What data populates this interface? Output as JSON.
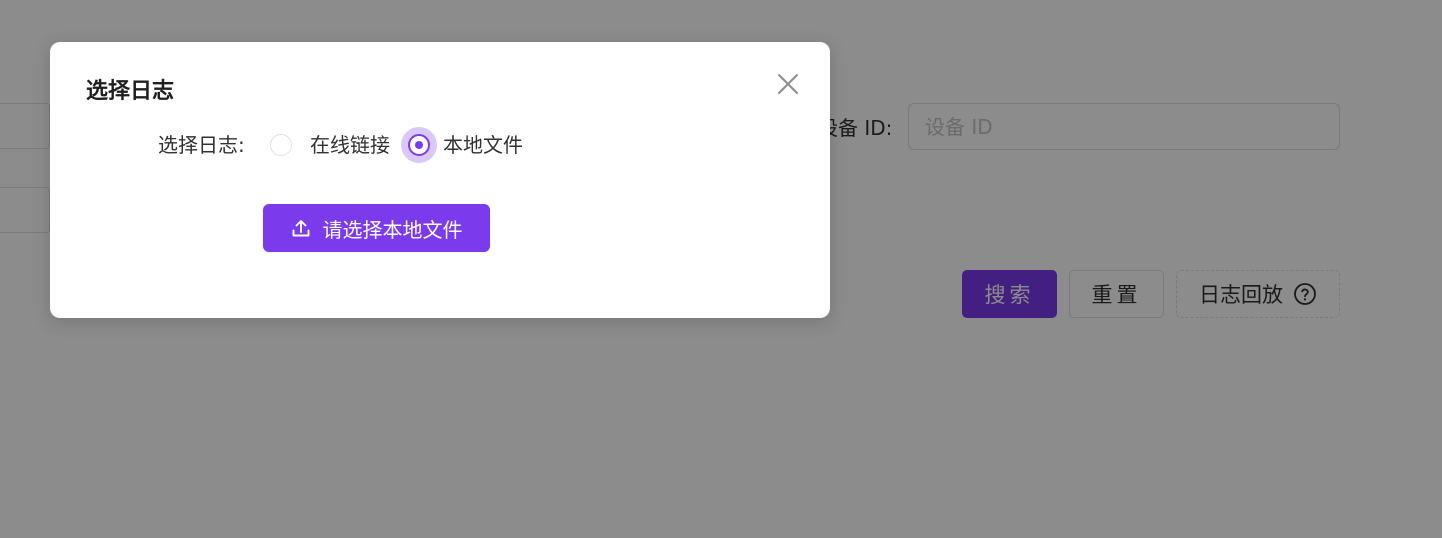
{
  "background": {
    "device_id_label": "设备 ID:",
    "device_id_placeholder": "设备 ID",
    "search_button": "搜索",
    "reset_button": "重置",
    "log_replay_button": "日志回放"
  },
  "modal": {
    "title": "选择日志",
    "form_label": "选择日志:",
    "options": [
      {
        "label": "在线链接",
        "checked": false
      },
      {
        "label": "本地文件",
        "checked": true
      }
    ],
    "upload_button": "请选择本地文件"
  },
  "colors": {
    "primary": "#7c3aed",
    "overlay": "rgba(0,0,0,0.45)"
  },
  "icons": {
    "close": "close-icon",
    "upload": "upload-icon",
    "help": "question-circle-icon"
  }
}
